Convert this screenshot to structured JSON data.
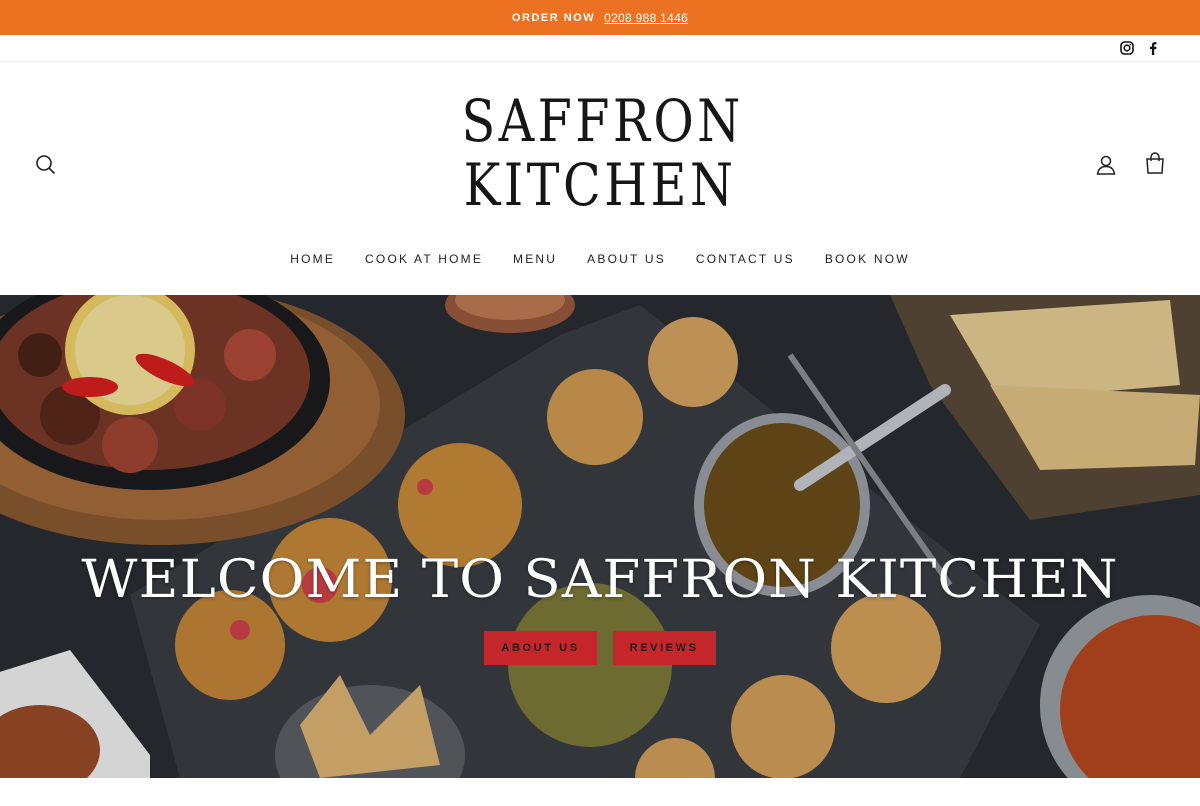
{
  "announcement": {
    "label": "ORDER NOW",
    "phone": "0208 988 1446"
  },
  "social": {
    "icons": [
      "instagram-icon",
      "facebook-icon"
    ]
  },
  "logo": {
    "line1": "SAFFRON",
    "line2": "KITCHEN"
  },
  "header_icons": [
    "search-icon",
    "account-icon",
    "cart-icon"
  ],
  "nav": [
    {
      "label": "HOME"
    },
    {
      "label": "COOK AT HOME"
    },
    {
      "label": "MENU"
    },
    {
      "label": "ABOUT US"
    },
    {
      "label": "CONTACT US"
    },
    {
      "label": "BOOK NOW"
    }
  ],
  "hero": {
    "title": "WELCOME TO SAFFRON KITCHEN",
    "buttons": [
      {
        "label": "ABOUT US"
      },
      {
        "label": "REVIEWS"
      }
    ]
  },
  "colors": {
    "accent": "#ec7121",
    "button": "#c5262c"
  }
}
